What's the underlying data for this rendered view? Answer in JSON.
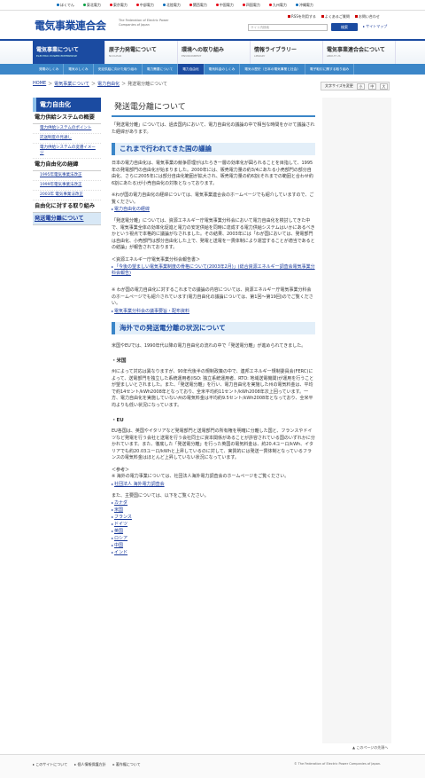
{
  "util": {
    "items": [
      {
        "label": "ほくでん",
        "color": "#0068b7"
      },
      {
        "label": "東北電力",
        "color": "#00a040"
      },
      {
        "label": "東京電力",
        "color": "#e60012"
      },
      {
        "label": "中部電力",
        "color": "#e60012"
      },
      {
        "label": "北陸電力",
        "color": "#0068b7"
      },
      {
        "label": "関西電力",
        "color": "#e60012"
      },
      {
        "label": "中国電力",
        "color": "#e60012"
      },
      {
        "label": "四国電力",
        "color": "#e60012"
      },
      {
        "label": "九州電力",
        "color": "#e60012"
      },
      {
        "label": "沖縄電力",
        "color": "#0068b7"
      }
    ]
  },
  "header": {
    "logo_jp": "電気事業連合会",
    "logo_en": "The Federation of Electric Power Companies of Japan",
    "links": [
      "RSSを利用する",
      "よくあるご質問",
      "お問い合わせ"
    ],
    "search_placeholder": "サイト内検索",
    "search_button": "検索",
    "sitemap": "サイトマップ"
  },
  "gnav": [
    {
      "jp": "電気事業について",
      "en": "ELECTRIC POWER ENTERPRISE",
      "active": true
    },
    {
      "jp": "原子力発電について",
      "en": "NUCLEAR",
      "active": false
    },
    {
      "jp": "環境への取り組み",
      "en": "ENVIRONMENT",
      "active": false
    },
    {
      "jp": "情報ライブラリー",
      "en": "LIBRARY",
      "active": false
    },
    {
      "jp": "電気事業連合会について",
      "en": "ABOUT US",
      "active": false
    }
  ],
  "snav": [
    {
      "label": "発電のしくみ",
      "active": false
    },
    {
      "label": "電気のしくみ",
      "active": false
    },
    {
      "label": "安定供給に向けた取り組み",
      "active": false
    },
    {
      "label": "電力需要について",
      "active": false
    },
    {
      "label": "電力自由化",
      "active": true
    },
    {
      "label": "電気料金のしくみ",
      "active": false
    },
    {
      "label": "電気の歴史（日本の電気事業と社会）",
      "active": false
    },
    {
      "label": "電子取引に関する取り組み",
      "active": false
    }
  ],
  "breadcrumb": {
    "home": "HOME",
    "l1": "電気事業について",
    "l2": "電力自由化",
    "current": "発送電分離について",
    "sep": "＞"
  },
  "fontsize": {
    "label": "文字サイズを変更",
    "small": "小",
    "mid": "中",
    "large": "大"
  },
  "sidebar": {
    "head": "電力自由化",
    "sec1": "電力供給システムの概要",
    "items1": [
      "電力供給システムのポイント",
      "託送制度の見通し",
      "電力供給システムの変遷イメージ"
    ],
    "sec2": "電力自由化の経緯",
    "items2": [
      "1995年電気事業法改正",
      "1999年電気事業法改正",
      "2003年 電気事業法改正"
    ],
    "sec3": "自由化に対する取り組み",
    "sec4": "発送電分離について"
  },
  "main": {
    "title": "発送電分離について",
    "intro": "「発送電分離」については、過去国内において、電力自由化の議論の中で相当な時間をかけて議論された経緯があります。",
    "h_history": "これまで行われてきた国の議論",
    "p1": "日本の電力自由化は、電気事業の競争原理がはたらき一層の効率化が図られることを目指して、1995年の発電部門の自由化が始まりました。2000年には、販売電力量の約3/4にあたる小売部門の部分自由化、さらに2005年には部分自由化範囲が拡大され、販売電力量の約6割(それまでの範囲と合わせ約6割にあたる)が小売自由化の対象となっております。",
    "p2": "※わが国の電力自由化の経緯については、電気事業連合会のホームページでも紹介していますので、ご覧ください。",
    "link1": "電力自由化の経緯",
    "p3": "「発送電分離」については、資源エネルギー庁電気事業分科会において電力自由化を検討してきた中で、電気事業全体の効率化促進と電力の安定供給を同時に達成する電力供給システムはいかにあるべきかという視点で本格的に議論がなされました。その結果、2003年には「わが国においては、発電部門は自由化、小売部門は部分自由化した上で、発電と送電を一貫体制により運営することが適当であるとの結論」が報告されております。",
    "ref_label": "＜資源エネルギー庁電気事業分科会報告書＞",
    "link2": "「今後の望ましい電気事業制度の骨格について(2003年2月)」(総合資源エネルギー調査会電気事業分科会報告)",
    "p4": "※ わが国の電力自由化に対するこれまでの議論の内容については、資源エネルギー庁電気事業分科会のホームページでも紹介されています(電力自由化の議論については、第1回～第19回)のでご覧ください。",
    "link3": "電気事業分科会の議事要旨・配布資料",
    "h_overseas": "海外での発送電分離の状況について",
    "p5": "米国やEUでは、1990年代以降の電力自由化の流れの中で「発送電分離」が進められてきました。",
    "us_head": "・米国",
    "p6": "州によって対応は異なりますが、90年代後半の規制政策の中で、連邦エネルギー規制委員会(FERC)によって、送電部門を独立した系統運用者(ISO: 独立系統運用者、RTO: 地域送電機関)が運用を行うことが望ましいとされました。また、「発送電分離」を行い、電力自由化を実施した州の電気料金は、平均で約14セント/kWh2008年となっており、全米平均約11セント/kWh2008年次上回っています。一方、電力自由化を実施していない州の電気料金は平均約9.5セント/kWh2008年となっており、全米平均よりも低い状況になっています。",
    "eu_head": "・EU",
    "p7": "EU各国は、英国やイタリアなど発電部門と送電部門の所有権を明確に分離した国と、フランスやドイツなど発電を行う会社と送電を行う会社同士に資本関係があることが許容されている国のいずれかに分かれています。また、徹底した「発送電分離」を行った英国の電気料金は、約20.4ユーロ/kWh、イタリアでも約20.03ユーロ/kWhと上昇しているのに対して、実質的には発送一貫体制となっているフランスの電気料金はほとんど上昇していない状況になっています。",
    "ref2_label": "＜参考＞",
    "p8": "※ 海外の電力事業については、社団法人海外電力調査会のホームページをご覧ください。",
    "link4": "社団法人 海外電力調査会",
    "p9": "また、主要国については、以下をご覧ください。",
    "countries": [
      "カナダ",
      "米国",
      "フランス",
      "ドイツ",
      "英国",
      "ロシア",
      "中国",
      "インド"
    ]
  },
  "pagetop": "このページの先頭へ",
  "footer": {
    "links": [
      "このサイトについて",
      "個人情報保護方針",
      "著作権について"
    ],
    "copyright": "© The Federation of Electric Power Companies of Japan."
  }
}
